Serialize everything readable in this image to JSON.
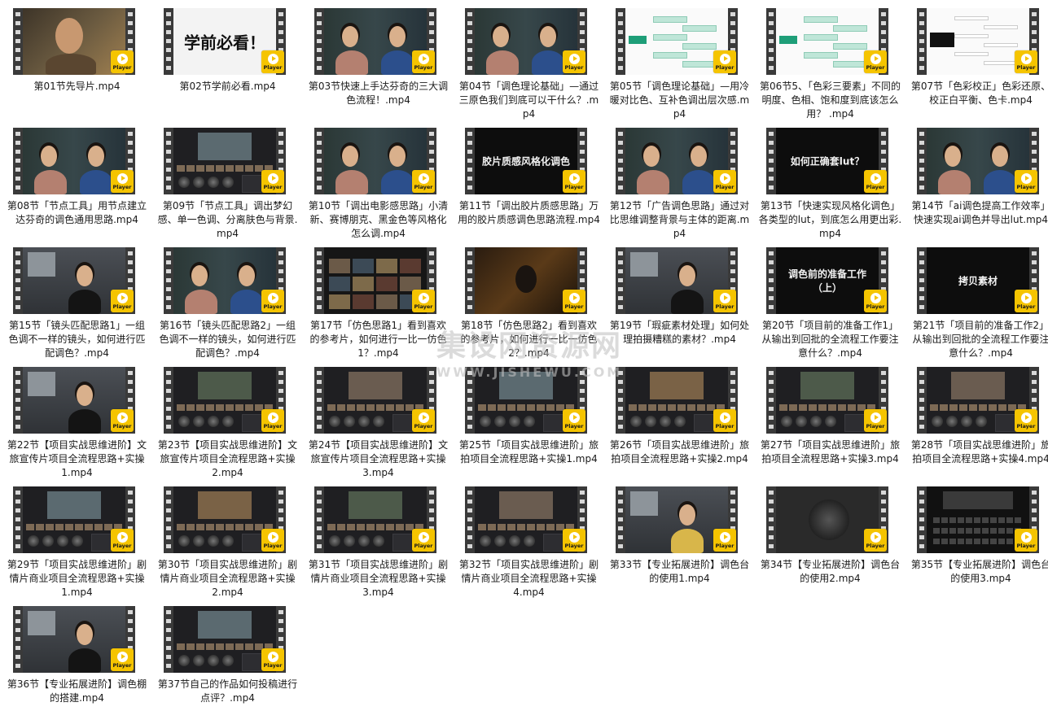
{
  "badge_label": "Player",
  "accent_color": "#f5c400",
  "watermark": {
    "main": "集设网资源网",
    "sub": "WWW.JISHEWU.COM"
  },
  "files": [
    {
      "name": "第01节先导片.mp4",
      "thumb": "portrait"
    },
    {
      "name": "第02节学前必看.mp4",
      "thumb": "title-white",
      "thumb_text": "学前必看！"
    },
    {
      "name": "第03节快速上手达芬奇的三大调色流程！.mp4",
      "thumb": "duo"
    },
    {
      "name": "第04节「调色理论基础」—通过三原色我们到底可以干什么？.mp4",
      "thumb": "duo"
    },
    {
      "name": "第05节「调色理论基础」—用冷暖对比色、互补色调出层次感.mp4",
      "thumb": "mind"
    },
    {
      "name": "第06节5、「色彩三要素」不同的明度、色相、饱和度到底该怎么用？ .mp4",
      "thumb": "mind"
    },
    {
      "name": "第07节「色彩校正」色彩还原、校正白平衡、色卡.mp4",
      "thumb": "mind-dark"
    },
    {
      "name": "第08节「节点工具」用节点建立达芬奇的调色通用思路.mp4",
      "thumb": "duo"
    },
    {
      "name": "第09节「节点工具」调出梦幻感、单一色调、分离肤色与背景.mp4",
      "thumb": "resolve"
    },
    {
      "name": "第10节「调出电影感思路」小清新、赛博朋克、黑金色等风格化怎么调.mp4",
      "thumb": "duo"
    },
    {
      "name": "第11节「调出胶片质感思路」万用的胶片质感调色思路流程.mp4",
      "thumb": "title-dark",
      "thumb_text": "胶片质感风格化调色"
    },
    {
      "name": "第12节「广告调色思路」通过对比思维调整背景与主体的距离.mp4",
      "thumb": "duo"
    },
    {
      "name": "第13节「快速实现风格化调色」各类型的lut，到底怎么用更出彩.mp4",
      "thumb": "title-dark",
      "thumb_text": "如何正确套lut？"
    },
    {
      "name": "第14节「ai调色提高工作效率」快速实现ai调色并导出lut.mp4",
      "thumb": "duo"
    },
    {
      "name": "第15节「镜头匹配思路1」一组色调不一样的镜头，如何进行匹配调色？.mp4",
      "thumb": "room"
    },
    {
      "name": "第16节「镜头匹配思路2」一组色调不一样的镜头，如何进行匹配调色？.mp4",
      "thumb": "duo"
    },
    {
      "name": "第17节「仿色思路1」看到喜欢的参考片，如何进行一比一仿色1？.mp4",
      "thumb": "web"
    },
    {
      "name": "第18节「仿色思路2」看到喜欢的参考片，如何进行一比一仿色2？.mp4",
      "thumb": "night"
    },
    {
      "name": "第19节「瑕疵素材处理」如何处理拍摄糟糕的素材？.mp4",
      "thumb": "room"
    },
    {
      "name": "第20节「项目前的准备工作1」从输出到回批的全流程工作要注意什么？.mp4",
      "thumb": "title-dark",
      "thumb_text": "调色前的准备工作（上）"
    },
    {
      "name": "第21节「项目前的准备工作2」从输出到回批的全流程工作要注意什么？.mp4",
      "thumb": "title-dark",
      "thumb_text": "拷贝素材"
    },
    {
      "name": "第22节【项目实战思维进阶】文旅宣传片项目全流程思路+实操1.mp4",
      "thumb": "room"
    },
    {
      "name": "第23节【项目实战思维进阶】文旅宣传片项目全流程思路+实操2.mp4",
      "thumb": "resolve"
    },
    {
      "name": "第24节【项目实战思维进阶】文旅宣传片项目全流程思路+实操3.mp4",
      "thumb": "resolve"
    },
    {
      "name": "第25节「项目实战思维进阶」旅拍项目全流程思路+实操1.mp4",
      "thumb": "resolve"
    },
    {
      "name": "第26节「项目实战思维进阶」旅拍项目全流程思路+实操2.mp4",
      "thumb": "resolve"
    },
    {
      "name": "第27节「项目实战思维进阶」旅拍项目全流程思路+实操3.mp4",
      "thumb": "resolve"
    },
    {
      "name": "第28节「项目实战思维进阶」旅拍项目全流程思路+实操4.mp4",
      "thumb": "resolve"
    },
    {
      "name": "第29节「项目实战思维进阶」剧情片商业项目全流程思路+实操1.mp4",
      "thumb": "resolve"
    },
    {
      "name": "第30节「项目实战思维进阶」剧情片商业项目全流程思路+实操2.mp4",
      "thumb": "resolve"
    },
    {
      "name": "第31节「项目实战思维进阶」剧情片商业项目全流程思路+实操3.mp4",
      "thumb": "resolve"
    },
    {
      "name": "第32节「项目实战思维进阶」剧情片商业项目全流程思路+实操4.mp4",
      "thumb": "resolve"
    },
    {
      "name": "第33节【专业拓展进阶】调色台的使用1.mp4",
      "thumb": "room-yellow"
    },
    {
      "name": "第34节【专业拓展进阶】调色台的使用2.mp4",
      "thumb": "grey"
    },
    {
      "name": "第35节【专业拓展进阶】调色台的使用3.mp4",
      "thumb": "cinema"
    },
    {
      "name": "第36节【专业拓展进阶】调色棚的搭建.mp4",
      "thumb": "room"
    },
    {
      "name": "第37节自己的作品如何投稿进行点评？.mp4",
      "thumb": "resolve"
    }
  ]
}
